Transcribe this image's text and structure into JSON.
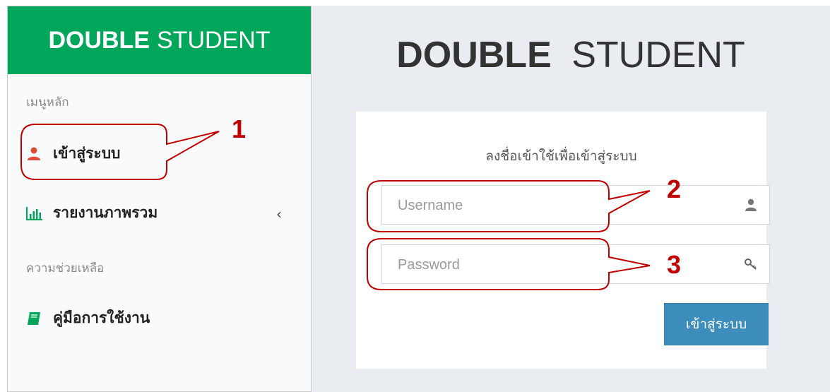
{
  "sidebar": {
    "brand_bold": "DOUBLE",
    "brand_rest": "STUDENT",
    "section_main": "เมนูหลัก",
    "items": [
      {
        "label": "เข้าสู่ระบบ",
        "icon": "user-icon"
      },
      {
        "label": "รายงานภาพรวม",
        "icon": "bar-chart-icon",
        "chevron": "‹"
      },
      {
        "label": "คู่มือการใช้งาน",
        "icon": "book-icon"
      }
    ],
    "section_help": "ความช่วยเหลือ"
  },
  "main": {
    "title_bold": "DOUBLE",
    "title_rest": "STUDENT",
    "login": {
      "message": "ลงชื่อเข้าใช้เพื่อเข้าสู่ระบบ",
      "username_placeholder": "Username",
      "username_value": "",
      "password_placeholder": "Password",
      "password_value": "",
      "submit_label": "เข้าสู่ระบบ"
    }
  },
  "annotations": {
    "labels": [
      "1",
      "2",
      "3"
    ],
    "color": "#c00000"
  },
  "colors": {
    "brand": "#00a65a",
    "button": "#3c8dbc",
    "user_icon": "#dd4b39",
    "chart_icon": "#00a65a",
    "book_icon": "#00a65a"
  }
}
